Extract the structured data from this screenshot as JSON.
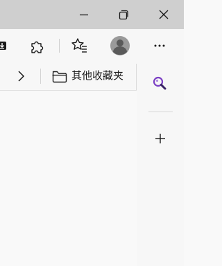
{
  "window_controls": {
    "minimize_icon": "minimize-icon",
    "restore_icon": "restore-icon",
    "close_icon": "close-icon"
  },
  "toolbar": {
    "download_icon": "download-icon",
    "extensions_icon": "extensions-puzzle-icon",
    "favorites_icon": "favorites-star-icon",
    "profile_icon": "profile-avatar-icon",
    "more_icon": "more-ellipsis-icon"
  },
  "favorites_bar": {
    "overflow_icon": "chevron-right-icon",
    "other_favorites_label": "其他收藏夹",
    "folder_icon": "folder-icon"
  },
  "sidebar": {
    "search_icon": "search-icon",
    "add_icon": "add-icon"
  },
  "colors": {
    "titlebar": "#cfcfcf",
    "toolbar": "#f7f7f7",
    "content": "#f9f9f9",
    "search_accent": "#7b3fc4"
  }
}
